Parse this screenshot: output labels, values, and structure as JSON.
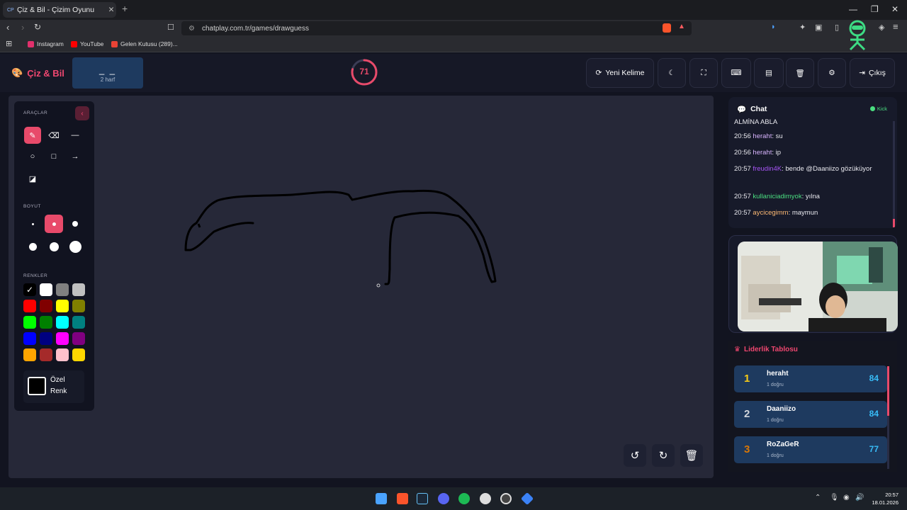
{
  "browser": {
    "tab_favicon": "CP",
    "tab_title": "Çiz & Bil - Çizim Oyunu",
    "url": "chatplay.com.tr/games/drawguess",
    "bookmarks": [
      "Instagram",
      "YouTube",
      "Gelen Kutusu (289)..."
    ],
    "bookmark_colors": [
      "#e1306c",
      "#ff0000",
      "#ea4335"
    ]
  },
  "header": {
    "logo": "Çiz & Bil",
    "word_mask": "_ _",
    "word_hint": "2 harf",
    "timer": "71",
    "timer_fraction": 0.79,
    "new_word_label": "Yeni Kelime",
    "exit_label": "Çıkış",
    "icons": [
      "refresh-icon",
      "moon-icon",
      "fullscreen-icon",
      "keyboard-icon",
      "archive-icon",
      "trash-icon",
      "gear-icon",
      "logout-icon"
    ]
  },
  "tools": {
    "section_tools": "ARAÇLAR",
    "section_size": "BOYUT",
    "section_colors": "RENKLER",
    "custom_color_label": "Özel Renk",
    "tool_icons": [
      "brush-icon",
      "eraser-icon",
      "line-icon",
      "circle-icon",
      "square-icon",
      "arrow-icon",
      "fill-bucket-icon"
    ],
    "active_tool": "brush-icon",
    "active_size_index": 1,
    "palette": [
      "#000000",
      "#ffffff",
      "#808080",
      "#c0c0c0",
      "#ff0000",
      "#800000",
      "#ffff00",
      "#808000",
      "#00ff00",
      "#008000",
      "#00ffff",
      "#008080",
      "#0000ff",
      "#000080",
      "#ff00ff",
      "#800080",
      "#ffa500",
      "#a52a2a",
      "#ffc0cb",
      "#ffd700"
    ],
    "selected_color": "#000000",
    "accent": "#e84a6a"
  },
  "chat": {
    "title": "Chat",
    "platform": "Kick",
    "messages": [
      {
        "time": "",
        "user": "",
        "user_color": "#e8e8ee",
        "text": "ALMİNA ABLA"
      },
      {
        "time": "20:56",
        "user": "heraht",
        "user_color": "#d8b4fe",
        "text": ": su"
      },
      {
        "time": "20:56",
        "user": "heraht",
        "user_color": "#d8b4fe",
        "text": ": ip"
      },
      {
        "time": "20:57",
        "user": "freudin4K",
        "user_color": "#a855f7",
        "text": ": bende @Daaniizo gözüküyor"
      },
      {
        "time": "20:57",
        "user": "kullaniciadimyok",
        "user_color": "#4ade80",
        "text": ": yılna"
      },
      {
        "time": "20:57",
        "user": "aycicegimm",
        "user_color": "#fdba74",
        "text": ": maymun"
      }
    ]
  },
  "leaderboard": {
    "title": "Liderlik Tablosu",
    "rows": [
      {
        "rank": "1",
        "rank_color": "#facc15",
        "name": "heraht",
        "sub": "1 doğru",
        "score": "84"
      },
      {
        "rank": "2",
        "rank_color": "#d1d5db",
        "name": "Daaniizo",
        "sub": "1 doğru",
        "score": "84"
      },
      {
        "rank": "3",
        "rank_color": "#d97706",
        "name": "RoZaGeR",
        "sub": "1 doğru",
        "score": "77"
      }
    ]
  },
  "taskbar": {
    "time": "20:57",
    "date": "18.01.2026",
    "apps": [
      "windows-start-icon",
      "brave-icon",
      "steam-icon",
      "discord-icon",
      "spotify-icon",
      "steelseries-icon",
      "obs-icon",
      "app-icon"
    ]
  }
}
